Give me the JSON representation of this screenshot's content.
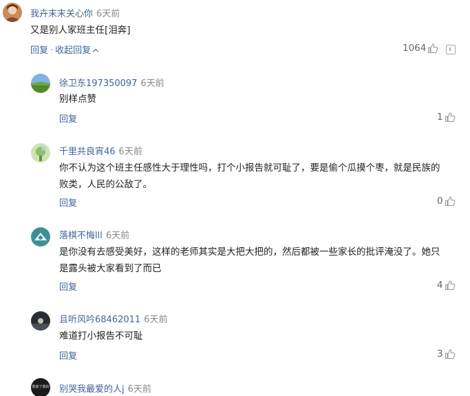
{
  "comments": [
    {
      "user": "我卉末末关心你",
      "time": "6天前",
      "text": "又是别人家班主任[泪奔]",
      "reply_label": "回复",
      "separator": "·",
      "collapse_label": "收起回复",
      "likes": "1064",
      "avatar": "avatar-orange"
    },
    {
      "user": "徐卫东197350097",
      "time": "6天前",
      "text": "别样点赞",
      "reply_label": "回复",
      "likes": "1",
      "avatar": "avatar-field"
    },
    {
      "user": "千里共良宵46",
      "time": "6天前",
      "text_line1": "你不认为这个班主任感性大于理性吗，打个小报告就可耻了，要是偷个瓜摸个枣，就是民族的",
      "text_line2": "败类，人民的公敌了。",
      "reply_label": "回复",
      "likes": "0",
      "avatar": "avatar-green"
    },
    {
      "user": "落棋不悔lll",
      "time": "6天前",
      "text_line1": "是你没有去感受美好，这样的老师其实是大把大把的，然后都被一些家长的批评淹没了。她只",
      "text_line2": "是露头被大家看到了而已",
      "reply_label": "回复",
      "likes": "4",
      "avatar": "avatar-teal"
    },
    {
      "user": "且听风吟68462011",
      "time": "6天前",
      "text": "难道打小报告不可耻",
      "reply_label": "回复",
      "likes": "3",
      "avatar": "avatar-night"
    },
    {
      "user": "别哭我最爱的人j",
      "time": "6天前",
      "avatar": "avatar-dark",
      "avatar_text": "我家了我的"
    }
  ],
  "icons": {
    "like": "thumbs-up-icon",
    "report": "report-icon",
    "collapse": "chevron-up-icon"
  },
  "colors": {
    "link": "#406599",
    "meta": "#888888",
    "text": "#222222"
  }
}
